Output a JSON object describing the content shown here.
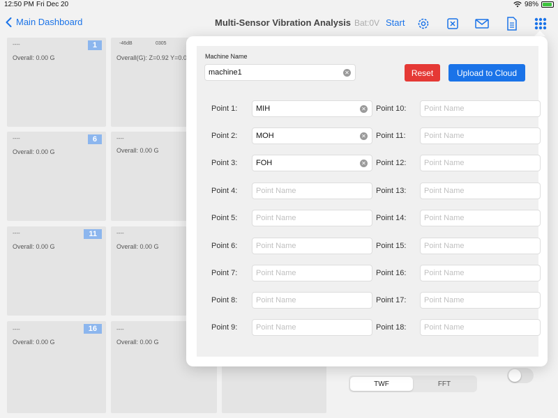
{
  "status": {
    "time": "12:50 PM",
    "date": "Fri Dec 20",
    "battery": "98%"
  },
  "nav": {
    "back_label": "Main Dashboard",
    "title": "Multi-Sensor Vibration Analysis",
    "battery_text": "Bat:0V",
    "start_label": "Start",
    "icons": [
      "gear-icon",
      "close-box-icon",
      "mail-icon",
      "document-icon",
      "grid-icon"
    ]
  },
  "colors": {
    "accent": "#1a73e8",
    "reset": "#e53935",
    "tile_badge": "#8cb6ee"
  },
  "tiles": {
    "t1": {
      "dash": "----",
      "overall": "Overall: 0.00 G",
      "num": "1"
    },
    "t2": {
      "db": "-46dB",
      "code": "0305",
      "overall": "Overall(G): Z=0.92 Y=0.0"
    },
    "t6": {
      "dash": "----",
      "overall": "Overall: 0.00 G",
      "num": "6"
    },
    "t7": {
      "dash": "----",
      "overall": "Overall: 0.00 G"
    },
    "t11": {
      "dash": "----",
      "overall": "Overall: 0.00 G",
      "num": "11"
    },
    "t12": {
      "dash": "----",
      "overall": "Overall: 0.00 G"
    },
    "t16": {
      "dash": "----",
      "overall": "Overall: 0.00 G",
      "num": "16"
    },
    "t17": {
      "dash": "----",
      "overall": "Overall: 0.00 G"
    }
  },
  "segment": {
    "twf": "TWF",
    "fft": "FFT",
    "selected": "TWF"
  },
  "popover": {
    "machine_label": "Machine Name",
    "machine_value": "machine1",
    "reset_label": "Reset",
    "upload_label": "Upload to Cloud",
    "placeholder": "Point Name",
    "points": {
      "p1": {
        "label": "Point 1:",
        "value": "MIH"
      },
      "p2": {
        "label": "Point 2:",
        "value": "MOH"
      },
      "p3": {
        "label": "Point 3:",
        "value": "FOH"
      },
      "p4": {
        "label": "Point 4:",
        "value": ""
      },
      "p5": {
        "label": "Point 5:",
        "value": ""
      },
      "p6": {
        "label": "Point 6:",
        "value": ""
      },
      "p7": {
        "label": "Point 7:",
        "value": ""
      },
      "p8": {
        "label": "Point 8:",
        "value": ""
      },
      "p9": {
        "label": "Point 9:",
        "value": ""
      },
      "p10": {
        "label": "Point 10:",
        "value": ""
      },
      "p11": {
        "label": "Point 11:",
        "value": ""
      },
      "p12": {
        "label": "Point 12:",
        "value": ""
      },
      "p13": {
        "label": "Point 13:",
        "value": ""
      },
      "p14": {
        "label": "Point 14:",
        "value": ""
      },
      "p15": {
        "label": "Point 15:",
        "value": ""
      },
      "p16": {
        "label": "Point 16:",
        "value": ""
      },
      "p17": {
        "label": "Point 17:",
        "value": ""
      },
      "p18": {
        "label": "Point 18:",
        "value": ""
      }
    }
  }
}
